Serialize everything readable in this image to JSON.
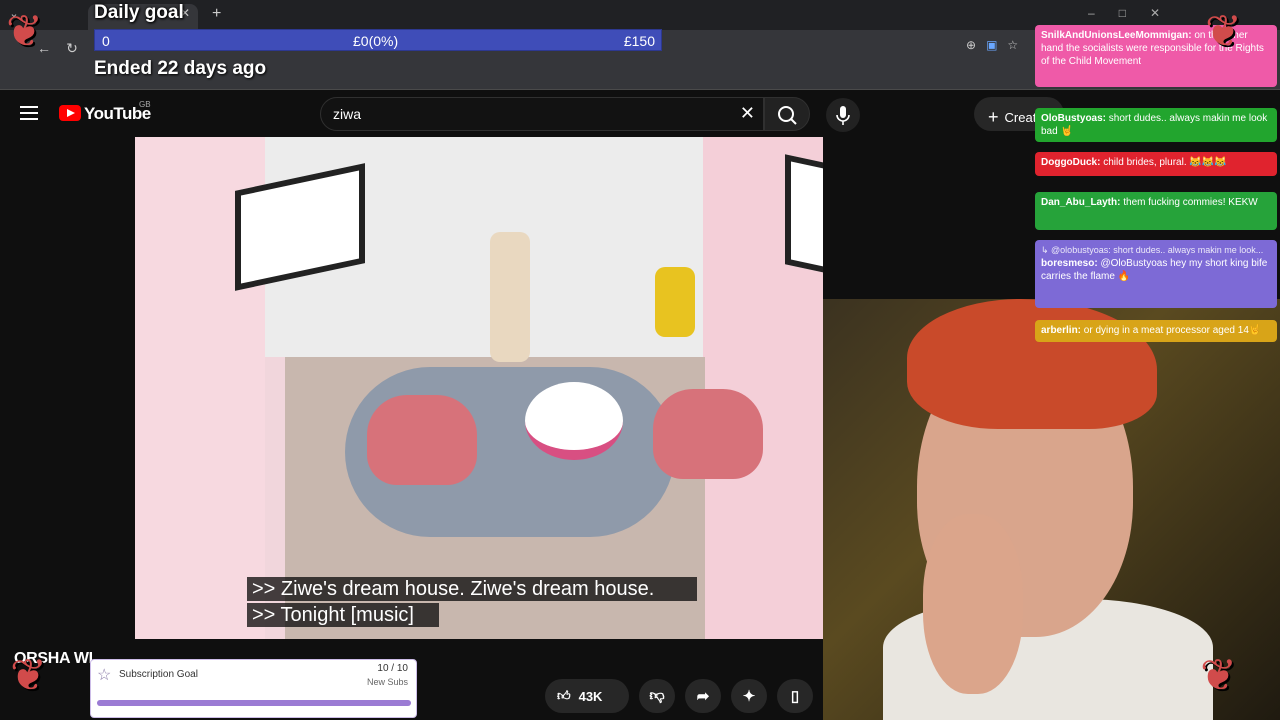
{
  "browser": {
    "tab_title": "",
    "new_tab": "+",
    "window_controls": [
      "–",
      "□",
      "✕"
    ]
  },
  "daily_goal": {
    "title": "Daily goal",
    "start": "0",
    "current": "£0(0%)",
    "target": "£150",
    "ended": "Ended 22 days ago"
  },
  "youtube": {
    "logo_text": "YouTube",
    "region": "GB",
    "search_value": "ziwa",
    "create_label": "Creat",
    "video_title": "ORSHA WI",
    "captions": [
      ">> Ziwe's dream house. Ziwe's dream house.",
      ">> Tonight [music]"
    ],
    "likes": "43K"
  },
  "sub_goal": {
    "label": "Subscription Goal",
    "count": "10 / 10",
    "sub": "New Subs",
    "progress": 1.0
  },
  "chat": [
    {
      "user": "SnilkAndUnionsLeeMommigan:",
      "text": "on the other hand the socialists were responsible for the Rights of the Child Movement",
      "color": "#ef5aa8"
    },
    {
      "user": "OloBustyoas:",
      "text": "short dudes.. always makin me look bad 🤘",
      "color": "#22a52e"
    },
    {
      "user": "DoggoDuck:",
      "text": "child brides, plural. 😹😹😹",
      "color": "#e0232e"
    },
    {
      "user": "Dan_Abu_Layth:",
      "text": "them fucking commies! KEKW",
      "color": "#26a33a"
    },
    {
      "user": "boresmeso:",
      "reply": "↳ @olobustyoas: short dudes.. always makin me look...",
      "text": "@OloBustyoas hey my short king bife carries the flame 🔥",
      "color": "#7d6ad6"
    },
    {
      "user": "arberlin:",
      "text": "or dying in a meat processor aged 14🤘",
      "color": "#d8a418"
    }
  ]
}
